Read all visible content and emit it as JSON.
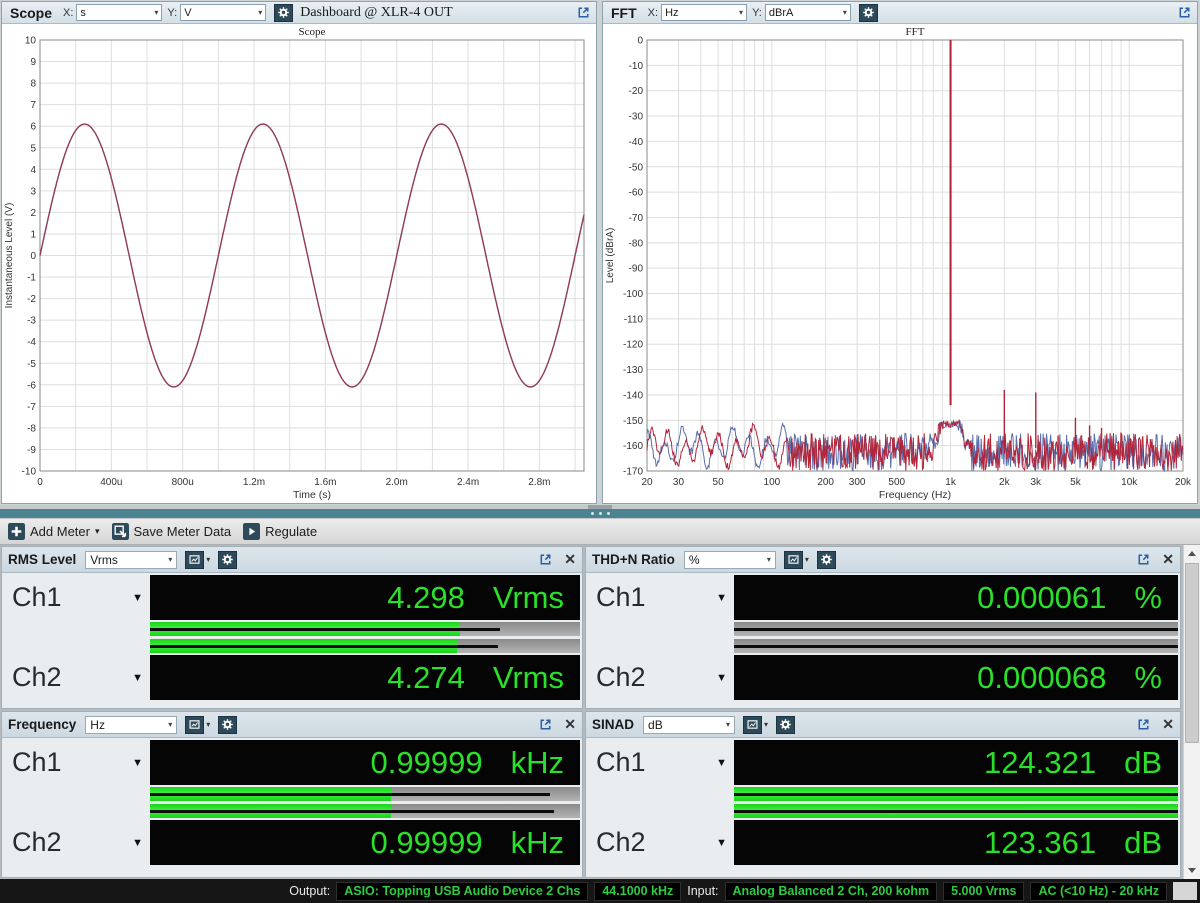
{
  "icons": {
    "dropdown": "▾",
    "channel_dropdown": "▼",
    "close": "✕"
  },
  "colors": {
    "meter_green": "#2ae02a",
    "status_green": "#2ecc40",
    "icon_dark": "#2d4a5a",
    "teal": "#4b8391"
  },
  "scope_panel": {
    "title": "Scope",
    "x_label": "X:",
    "x_value": "s",
    "y_label": "Y:",
    "y_value": "V",
    "dashboard_label": "Dashboard @ XLR-4 OUT"
  },
  "fft_panel": {
    "title": "FFT",
    "x_label": "X:",
    "x_value": "Hz",
    "y_label": "Y:",
    "y_value": "dBrA"
  },
  "toolbar": {
    "add_meter": "Add Meter",
    "save_meter_data": "Save Meter Data",
    "regulate": "Regulate"
  },
  "meters": [
    {
      "title": "RMS Level",
      "unit": "Vrms",
      "channels": [
        {
          "label": "Ch1",
          "value": "4.298",
          "unit": "Vrms",
          "fill": 0.72,
          "peak": 0.815
        },
        {
          "label": "Ch2",
          "value": "4.274",
          "unit": "Vrms",
          "fill": 0.715,
          "peak": 0.81
        }
      ]
    },
    {
      "title": "THD+N Ratio",
      "unit": "%",
      "channels": [
        {
          "label": "Ch1",
          "value": "0.000061",
          "unit": "%",
          "fill": 0,
          "peak": 1
        },
        {
          "label": "Ch2",
          "value": "0.000068",
          "unit": "%",
          "fill": 0,
          "peak": 1
        }
      ]
    },
    {
      "title": "Frequency",
      "unit": "Hz",
      "channels": [
        {
          "label": "Ch1",
          "value": "0.99999",
          "unit": "kHz",
          "fill": 0.56,
          "peak": 0.93
        },
        {
          "label": "Ch2",
          "value": "0.99999",
          "unit": "kHz",
          "fill": 0.56,
          "peak": 0.94
        }
      ]
    },
    {
      "title": "SINAD",
      "unit": "dB",
      "channels": [
        {
          "label": "Ch1",
          "value": "124.321",
          "unit": "dB",
          "fill": 1,
          "peak": 1
        },
        {
          "label": "Ch2",
          "value": "123.361",
          "unit": "dB",
          "fill": 1,
          "peak": 1
        }
      ]
    }
  ],
  "status_bar": {
    "output_label": "Output:",
    "output_badges": [
      "ASIO: Topping USB Audio Device 2 Chs",
      "44.1000 kHz"
    ],
    "input_label": "Input:",
    "input_badges": [
      "Analog Balanced 2 Ch, 200 kohm",
      "5.000 Vrms",
      "AC (<10 Hz) - 20 kHz"
    ]
  },
  "chart_data": [
    {
      "type": "line",
      "title": "Scope",
      "xlabel": "Time (s)",
      "ylabel": "Instantaneous Level (V)",
      "xlim": [
        0,
        0.00305
      ],
      "ylim": [
        -10,
        10
      ],
      "y_tick_step": 1,
      "x_grid_step": 0.0002,
      "x_ticks": [
        {
          "v": 0,
          "label": "0"
        },
        {
          "v": 0.0004,
          "label": "400u"
        },
        {
          "v": 0.0008,
          "label": "800u"
        },
        {
          "v": 0.0012,
          "label": "1.2m"
        },
        {
          "v": 0.0016,
          "label": "1.6m"
        },
        {
          "v": 0.002,
          "label": "2.0m"
        },
        {
          "v": 0.0024,
          "label": "2.4m"
        },
        {
          "v": 0.0028,
          "label": "2.8m"
        }
      ],
      "signal": {
        "shape": "sine",
        "amplitude_v": 6.1,
        "frequency_hz": 1000,
        "phase_deg": 0
      },
      "series": [
        {
          "name": "Ch1",
          "color": "#993a4e"
        },
        {
          "name": "Ch2",
          "color": "#5a6fae"
        }
      ],
      "grid": true,
      "legend": "none"
    },
    {
      "type": "line",
      "title": "FFT",
      "xlabel": "Frequency (Hz)",
      "ylabel": "Level (dBrA)",
      "x_scale": "log",
      "xlim": [
        20,
        20000
      ],
      "ylim": [
        -170,
        0
      ],
      "y_tick_step": 10,
      "x_ticks": [
        {
          "v": 20,
          "label": "20"
        },
        {
          "v": 30,
          "label": "30"
        },
        {
          "v": 50,
          "label": "50"
        },
        {
          "v": 100,
          "label": "100"
        },
        {
          "v": 200,
          "label": "200"
        },
        {
          "v": 300,
          "label": "300"
        },
        {
          "v": 500,
          "label": "500"
        },
        {
          "v": 1000,
          "label": "1k"
        },
        {
          "v": 2000,
          "label": "2k"
        },
        {
          "v": 3000,
          "label": "3k"
        },
        {
          "v": 5000,
          "label": "5k"
        },
        {
          "v": 10000,
          "label": "10k"
        },
        {
          "v": 20000,
          "label": "20k"
        }
      ],
      "fundamental": {
        "freq_hz": 1000,
        "level_db": 0
      },
      "noise_floor_db": [
        -170,
        -155
      ],
      "spurs": [
        {
          "freq_hz": 2000,
          "level_db": -138
        },
        {
          "freq_hz": 3000,
          "level_db": -139
        },
        {
          "freq_hz": 4000,
          "level_db": -156
        },
        {
          "freq_hz": 5000,
          "level_db": -149
        },
        {
          "freq_hz": 6000,
          "level_db": -152
        },
        {
          "freq_hz": 7000,
          "level_db": -153
        },
        {
          "freq_hz": 9000,
          "level_db": -155
        }
      ],
      "series": [
        {
          "name": "Ch1",
          "color": "#b22438"
        },
        {
          "name": "Ch2",
          "color": "#5a6fae"
        }
      ],
      "grid": true,
      "legend": "none"
    }
  ]
}
